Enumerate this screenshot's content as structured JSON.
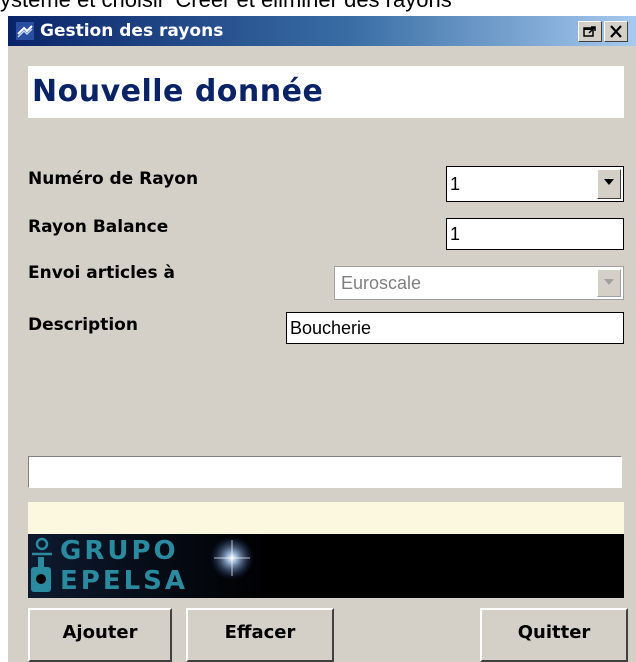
{
  "page_caption": "ystème et choisir 'Créer et éliminer des rayons'",
  "window": {
    "title": "Gestion des rayons",
    "title_icon": "app-icon",
    "controls": [
      "restore-icon",
      "close-icon"
    ]
  },
  "header": {
    "title": "Nouvelle donnée"
  },
  "form": {
    "numero_rayon": {
      "label": "Numéro de Rayon",
      "value": "1"
    },
    "rayon_balance": {
      "label": "Rayon Balance",
      "value": "1"
    },
    "envoi_articles": {
      "label": "Envoi articles à",
      "value": "Euroscale",
      "enabled": false
    },
    "description": {
      "label": "Description",
      "value": "Boucherie"
    }
  },
  "status": {
    "text": ""
  },
  "banner": {
    "line1": "GRUPO",
    "line2": "EPELSA",
    "logo_text_color": "#2a8aa0"
  },
  "buttons": {
    "add": "Ajouter",
    "clear": "Effacer",
    "quit": "Quitter"
  },
  "colors": {
    "title_bar": "#0a246a",
    "header_text": "#0a2266",
    "window_bg": "#d4d0c8"
  }
}
